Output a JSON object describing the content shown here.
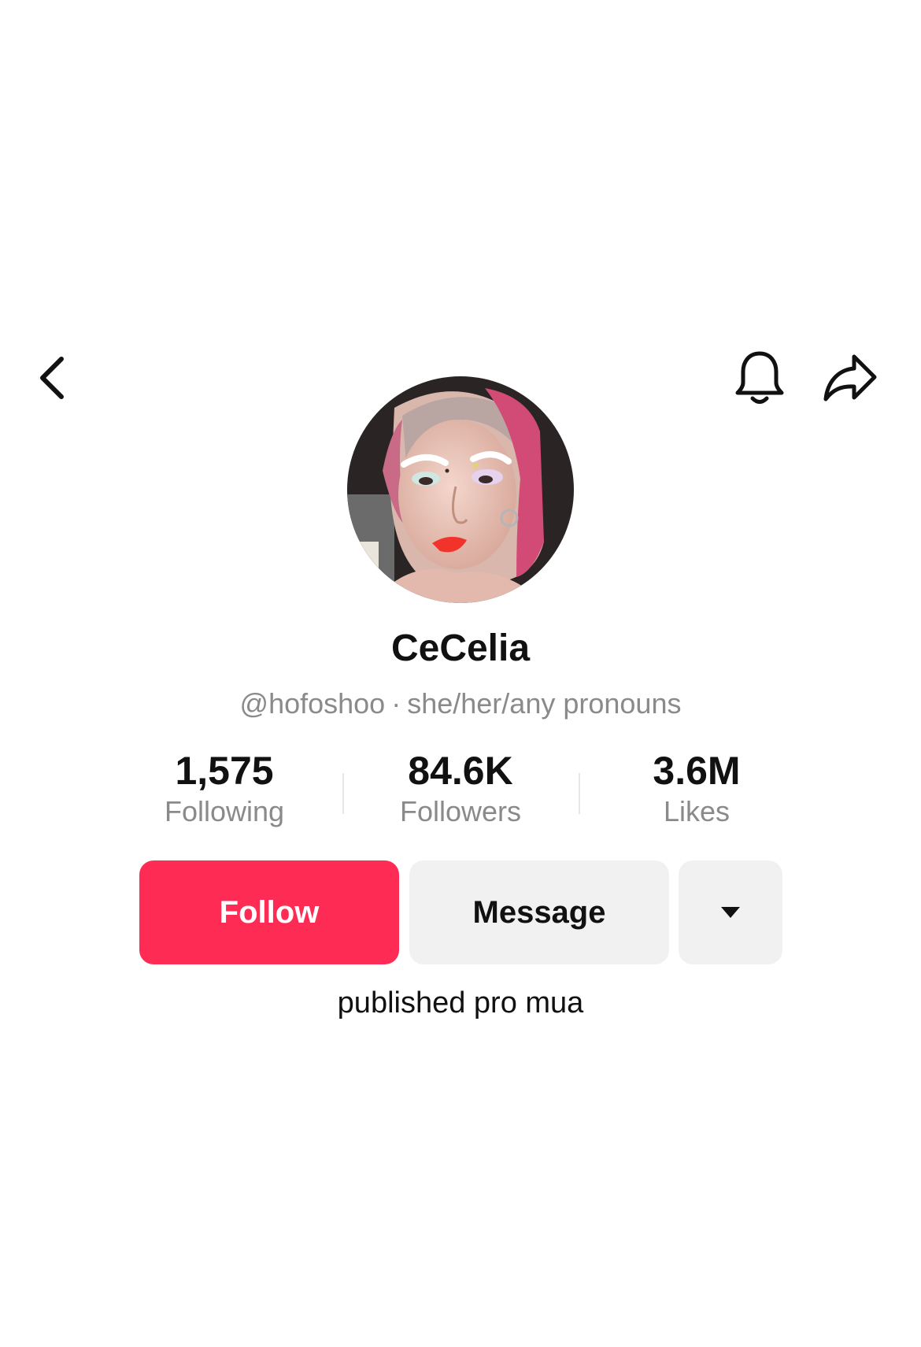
{
  "header": {
    "back_icon": "chevron-left-icon",
    "notification_icon": "bell-icon",
    "share_icon": "share-arrow-icon"
  },
  "profile": {
    "avatar": "profile-photo",
    "display_name": "CeCelia",
    "handle": "@hofoshoo",
    "separator": "·",
    "pronouns": "she/her/any pronouns",
    "bio": "published pro mua"
  },
  "stats": [
    {
      "value": "1,575",
      "label": "Following"
    },
    {
      "value": "84.6K",
      "label": "Followers"
    },
    {
      "value": "3.6M",
      "label": "Likes"
    }
  ],
  "actions": {
    "follow_label": "Follow",
    "message_label": "Message",
    "more_icon": "caret-down-icon"
  },
  "colors": {
    "accent": "#fe2c55",
    "secondary_button": "#f1f1f2",
    "muted_text": "#8a8a8a",
    "primary_text": "#111111"
  }
}
